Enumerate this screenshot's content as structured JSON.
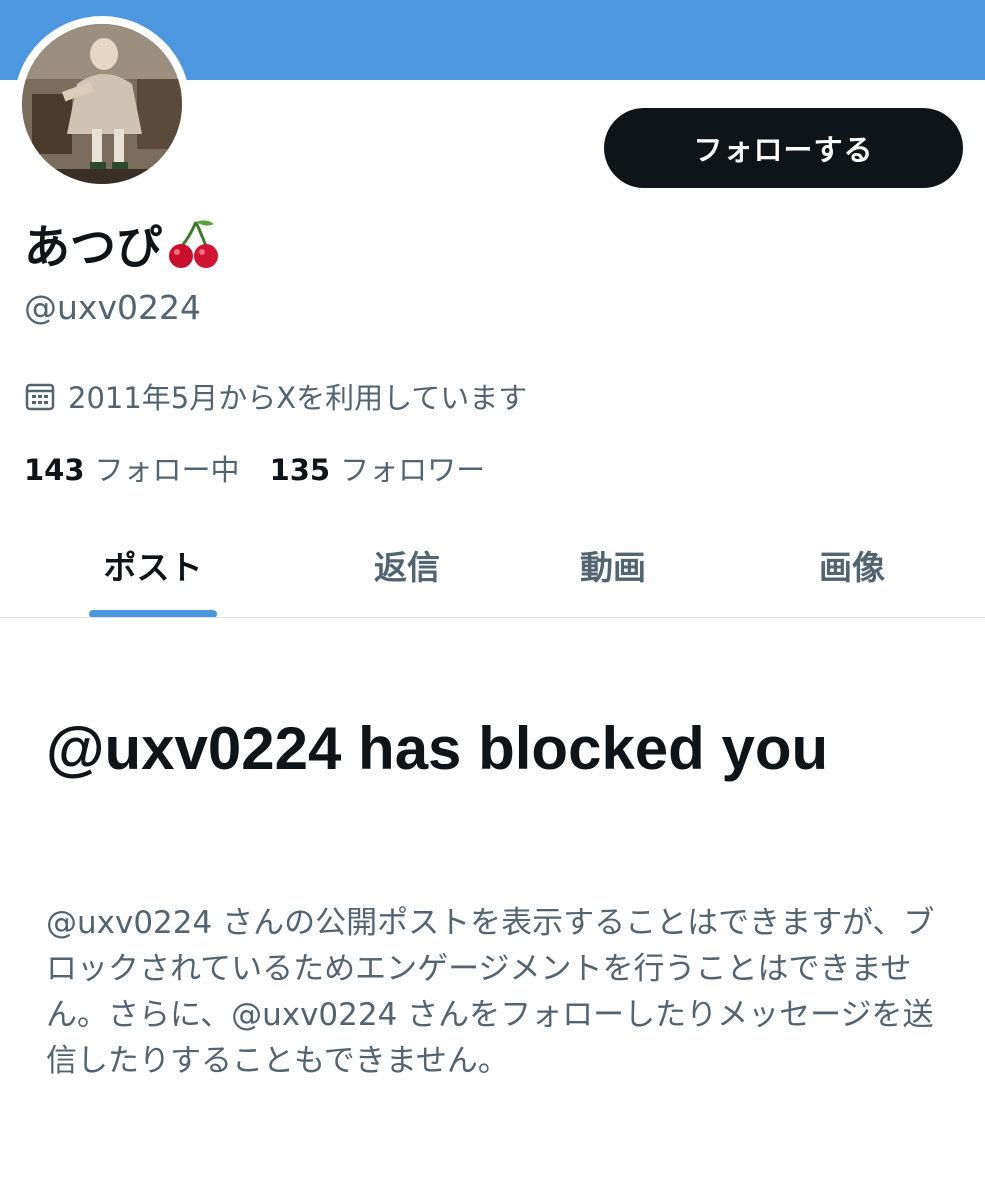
{
  "profile": {
    "display_name": "あつぴ",
    "name_emoji": "cherry-emoji",
    "handle": "@uxv0224",
    "joined_text": "2011年5月からXを利用しています",
    "following_count": "143",
    "following_label": "フォロー中",
    "followers_count": "135",
    "followers_label": "フォロワー"
  },
  "header": {
    "banner_color": "#4d96e0",
    "follow_button_label": "フォローする"
  },
  "tabs": [
    {
      "label": "ポスト",
      "active": true
    },
    {
      "label": "返信",
      "active": false
    },
    {
      "label": "動画",
      "active": false
    },
    {
      "label": "画像",
      "active": false
    }
  ],
  "blocked_notice": {
    "title": "@uxv0224 has blocked you",
    "body": "@uxv0224 さんの公開ポストを表示することはできますが、ブロックされているためエンゲージメントを行うことはできません。さらに、@uxv0224 さんをフォローしたりメッセージを送信したりすることもできません。"
  },
  "icons": {
    "calendar": "calendar-icon",
    "cherry": "cherry-icon"
  },
  "colors": {
    "accent": "#4d96e0",
    "text_primary": "#0f1419",
    "text_secondary": "#536471"
  }
}
